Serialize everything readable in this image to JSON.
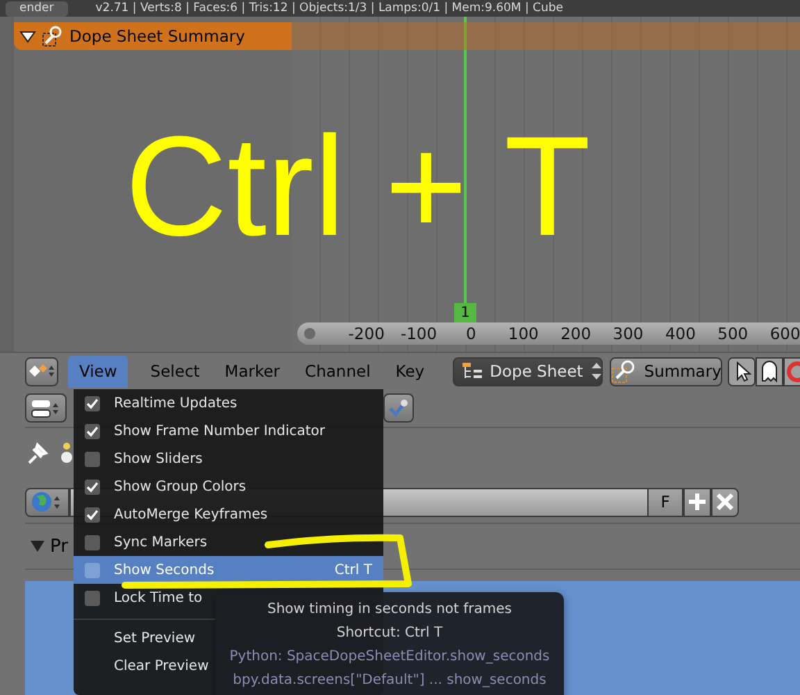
{
  "info_bar": {
    "editor_label": "ender",
    "stats": "v2.71 | Verts:8 | Faces:6 | Tris:12 | Objects:1/3 | Lamps:0/1 | Mem:9.60M | Cube"
  },
  "summary_channel": {
    "label": "Dope Sheet Summary",
    "expanded": true
  },
  "overlay_caption": "Ctrl + T",
  "current_frame": "1",
  "ruler_ticks": [
    "-200",
    "-100",
    "0",
    "100",
    "200",
    "300",
    "400",
    "500",
    "600"
  ],
  "header": {
    "menus": [
      {
        "label": "View",
        "selected": true
      },
      {
        "label": "Select",
        "selected": false
      },
      {
        "label": "Marker",
        "selected": false
      },
      {
        "label": "Channel",
        "selected": false
      },
      {
        "label": "Key",
        "selected": false
      }
    ],
    "mode": "Dope Sheet",
    "summary": "Summary"
  },
  "world_field": {
    "fake_user": "F"
  },
  "panel": {
    "title": "Pr",
    "expanded": true
  },
  "view_menu": [
    {
      "kind": "check",
      "label": "Realtime Updates",
      "checked": true,
      "selected": false
    },
    {
      "kind": "check",
      "label": "Show Frame Number Indicator",
      "checked": true,
      "selected": false
    },
    {
      "kind": "check",
      "label": "Show Sliders",
      "checked": false,
      "selected": false
    },
    {
      "kind": "check",
      "label": "Show Group Colors",
      "checked": true,
      "selected": false
    },
    {
      "kind": "check",
      "label": "AutoMerge Keyframes",
      "checked": true,
      "selected": false
    },
    {
      "kind": "check",
      "label": "Sync Markers",
      "checked": false,
      "selected": false
    },
    {
      "kind": "check",
      "label": "Show Seconds",
      "checked": false,
      "selected": true,
      "shortcut": "Ctrl T"
    },
    {
      "kind": "check",
      "label": "Lock Time to",
      "checked": false,
      "selected": false
    },
    {
      "kind": "separator"
    },
    {
      "kind": "action",
      "label": "Set Preview",
      "selected": false
    },
    {
      "kind": "action",
      "label": "Clear Preview",
      "selected": false
    }
  ],
  "tooltip": [
    {
      "kind": "description",
      "text": "Show timing in seconds not frames"
    },
    {
      "kind": "shortcut",
      "text": "Shortcut: Ctrl T"
    },
    {
      "kind": "python",
      "text": "Python: SpaceDopeSheetEditor.show_seconds"
    },
    {
      "kind": "python",
      "text": "bpy.data.screens[\"Default\"] ... show_seconds"
    }
  ]
}
